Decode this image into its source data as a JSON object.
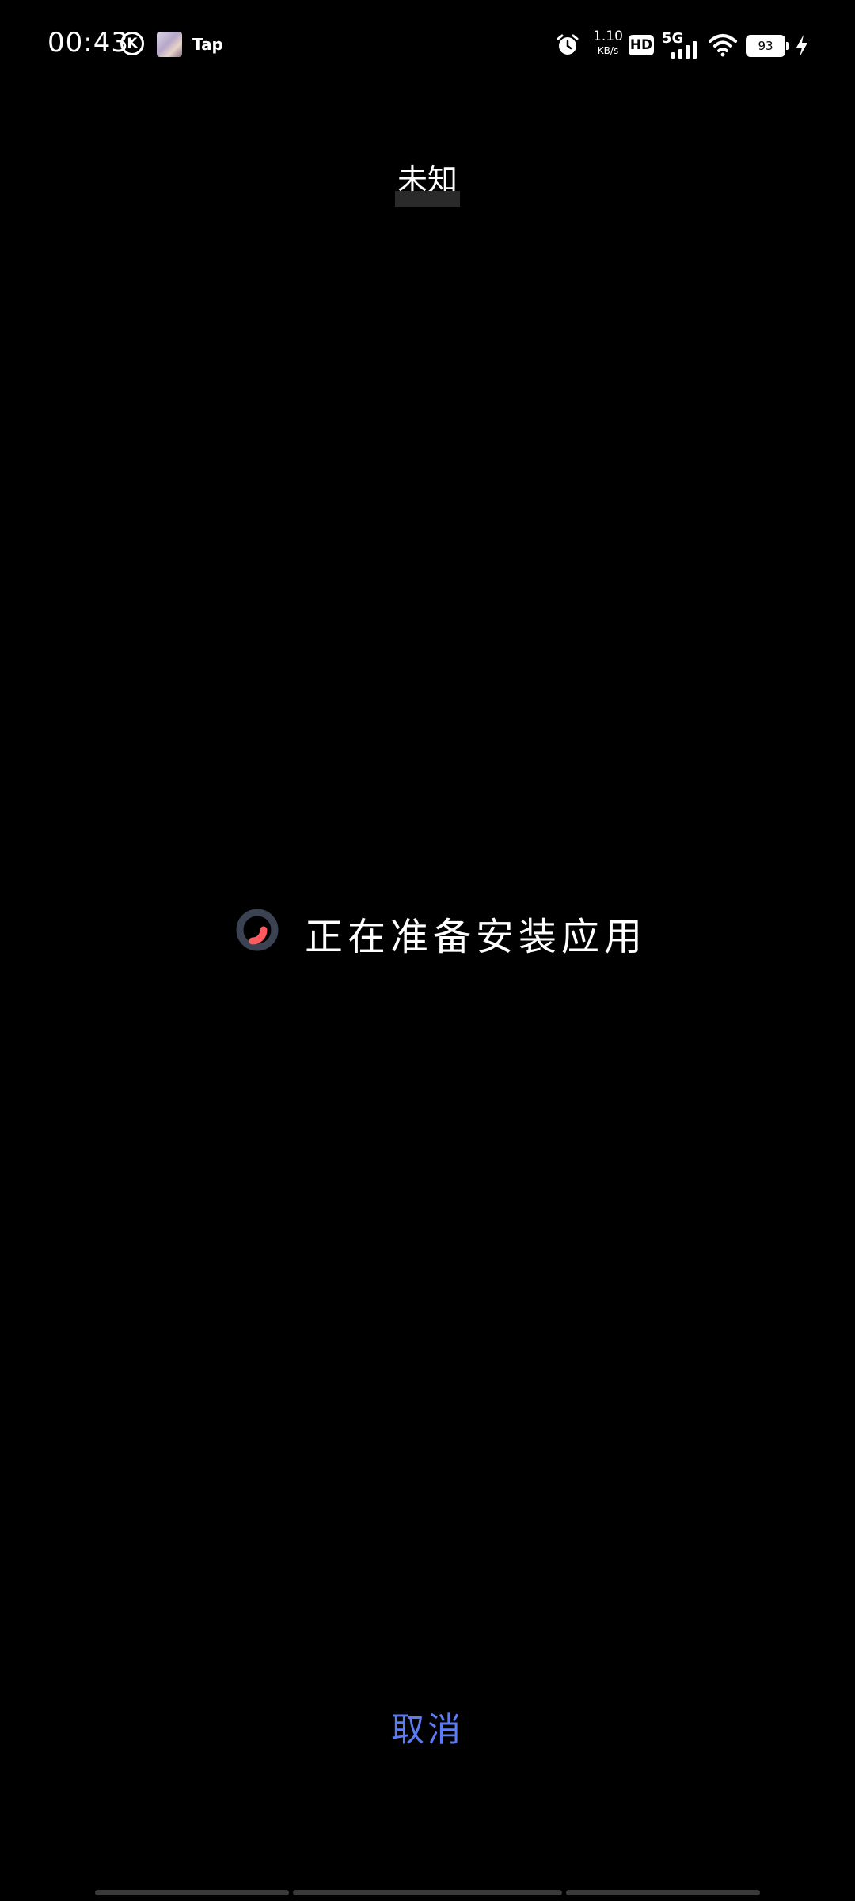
{
  "status_bar": {
    "time": "00:43",
    "k_icon_letter": "K",
    "app_label": "Tap",
    "net_speed_value": "1.10",
    "net_speed_unit": "KB/s",
    "hd_label": "HD",
    "network_label": "5G",
    "battery_level": "93",
    "icons": [
      "k-circle-icon",
      "app-thumbnail",
      "alarm-icon",
      "hd-icon",
      "signal-icon",
      "wifi-icon",
      "battery-icon",
      "charging-bolt-icon"
    ]
  },
  "header": {
    "app_name": "未知"
  },
  "progress": {
    "message": "正在准备安装应用",
    "spinner_colors": {
      "track": "#3b4252",
      "arc": "#ff5a5f"
    }
  },
  "actions": {
    "cancel_label": "取消",
    "accent_color": "#5b7cf5"
  }
}
